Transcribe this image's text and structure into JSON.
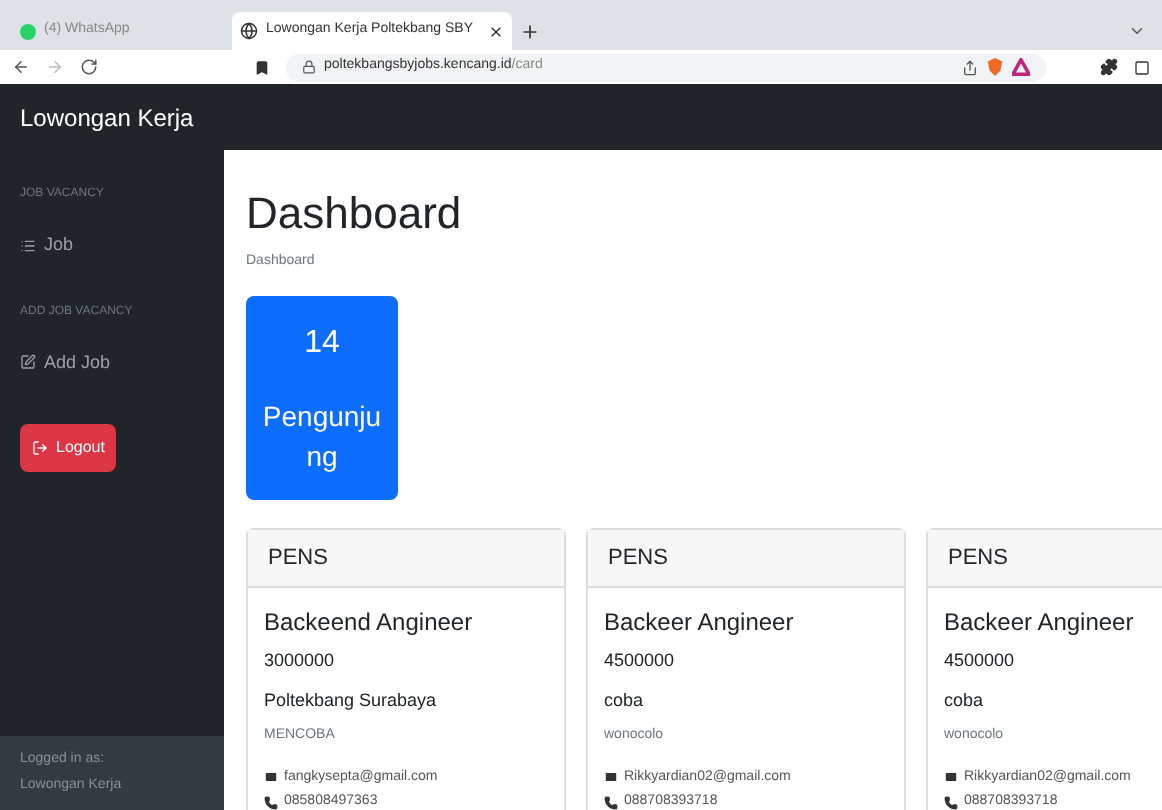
{
  "browser": {
    "tabs": [
      {
        "title": "(4) WhatsApp",
        "selected": false
      },
      {
        "title": "Lowongan Kerja Poltekbang SBY",
        "selected": true
      }
    ],
    "address_host": "poltekbangsbyjobs.kencang.id",
    "address_path": "/card"
  },
  "navbar": {
    "brand": "Lowongan Kerja"
  },
  "sidebar": {
    "sections": [
      {
        "heading": "JOB VACANCY",
        "items": [
          {
            "label": "Job",
            "kind": "list"
          }
        ]
      },
      {
        "heading": "ADD JOB VACANCY",
        "items": [
          {
            "label": "Add Job",
            "kind": "edit"
          }
        ]
      }
    ],
    "logout": "Logout",
    "footer": {
      "caption": "Logged in as:",
      "user": "Lowongan Kerja"
    }
  },
  "main": {
    "title": "Dashboard",
    "breadcrumb": "Dashboard",
    "stat": {
      "value": "14",
      "label": "Pengunjung"
    },
    "cards": [
      {
        "header": "PENS",
        "title": "Backeend Angineer",
        "salary": "3000000",
        "company": "Poltekbang Surabaya",
        "location": "MENCOBA",
        "email": "fangkysepta@gmail.com",
        "phone": "085808497363"
      },
      {
        "header": "PENS",
        "title": "Backeer Angineer",
        "salary": "4500000",
        "company": "coba",
        "location": "wonocolo",
        "email": "Rikkyardian02@gmail.com",
        "phone": "088708393718"
      },
      {
        "header": "PENS",
        "title": "Backeer Angineer",
        "salary": "4500000",
        "company": "coba",
        "location": "wonocolo",
        "email": "Rikkyardian02@gmail.com",
        "phone": "088708393718"
      }
    ]
  }
}
